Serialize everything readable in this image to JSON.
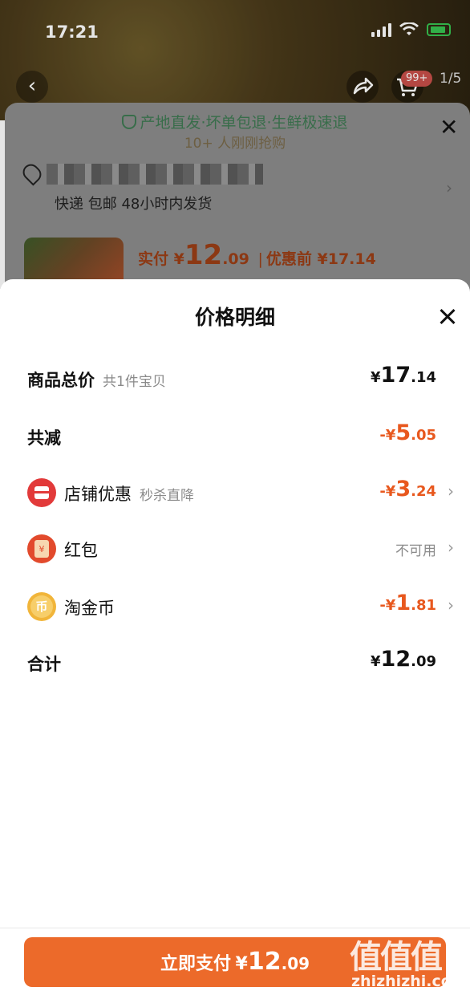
{
  "status_bar": {
    "time": "17:21"
  },
  "background": {
    "cart_badge": "99+",
    "page_indicator": "1/5",
    "guarantee": "产地直发·坏单包退·生鲜极速退",
    "buyers": "10+ 人刚刚抢购",
    "shipping": "快递 包邮 48小时内发货",
    "price_label": "实付",
    "price_currency": "¥",
    "price_int": "12",
    "price_dec": ".09",
    "before_discount": "优惠前 ¥17.14"
  },
  "sheet": {
    "title": "价格明细",
    "rows": {
      "total": {
        "label": "商品总价",
        "sub": "共1件宝贝",
        "cur": "¥",
        "int": "17",
        "dec": ".14"
      },
      "reduce": {
        "label": "共减",
        "cur": "-¥",
        "int": "5",
        "dec": ".05"
      },
      "shop": {
        "label": "店铺优惠",
        "sub": "秒杀直降",
        "cur": "-¥",
        "int": "3",
        "dec": ".24"
      },
      "redpacket": {
        "label": "红包",
        "value": "不可用"
      },
      "coin": {
        "label": "淘金币",
        "cur": "-¥",
        "int": "1",
        "dec": ".81"
      },
      "sum": {
        "label": "合计",
        "cur": "¥",
        "int": "12",
        "dec": ".09"
      }
    }
  },
  "pay_button": {
    "label": "立即支付",
    "cur": "¥",
    "int": "12",
    "dec": ".09"
  },
  "watermark": {
    "logo": "值值值",
    "url": "zhizhizhi.com"
  },
  "colors": {
    "accent": "#ec6a2a",
    "discount": "#e8581e"
  },
  "icons": [
    "back-icon",
    "share-icon",
    "cart-icon",
    "shield-icon",
    "location-icon",
    "close-icon",
    "shop-icon",
    "red-packet-icon",
    "coin-icon",
    "chevron-right-icon"
  ]
}
